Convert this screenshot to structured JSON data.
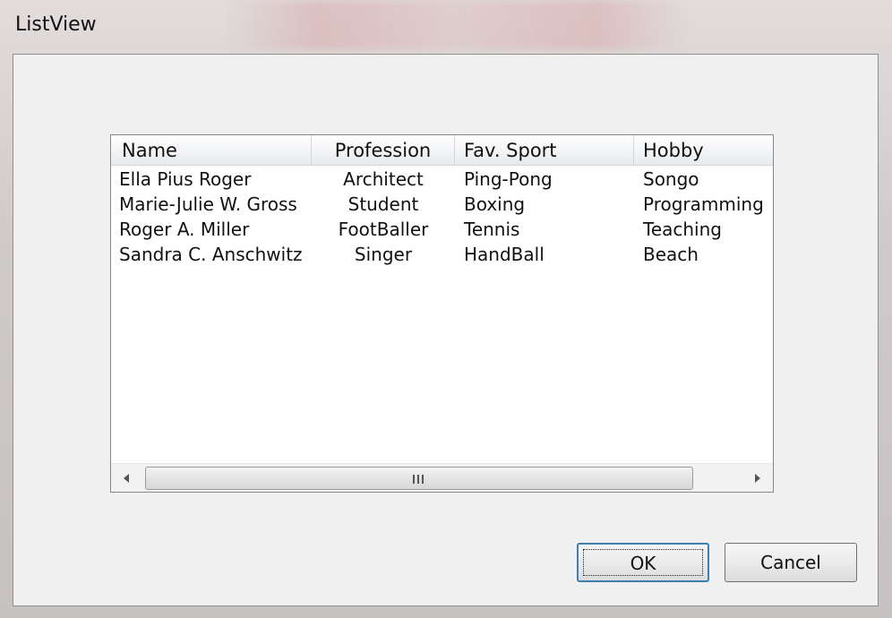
{
  "window": {
    "title": "ListView"
  },
  "listview": {
    "columns": [
      "Name",
      "Profession",
      "Fav. Sport",
      "Hobby"
    ],
    "rows": [
      {
        "name": "Ella Pius Roger",
        "profession": "Architect",
        "sport": "Ping-Pong",
        "hobby": "Songo"
      },
      {
        "name": "Marie-Julie W. Gross",
        "profession": "Student",
        "sport": "Boxing",
        "hobby": "Programming"
      },
      {
        "name": "Roger A. Miller",
        "profession": "FootBaller",
        "sport": "Tennis",
        "hobby": "Teaching"
      },
      {
        "name": "Sandra C. Anschwitz",
        "profession": "Singer",
        "sport": "HandBall",
        "hobby": "Beach"
      }
    ]
  },
  "buttons": {
    "ok_label": "OK",
    "cancel_label": "Cancel"
  },
  "icons": {
    "scroll_left": "chevron-left-icon",
    "scroll_right": "chevron-right-icon",
    "thumb_grip": "grip-icon"
  },
  "colors": {
    "focus_border": "#3c7fb1",
    "list_background": "#ffffff",
    "dialog_background": "#f0f0f0"
  }
}
